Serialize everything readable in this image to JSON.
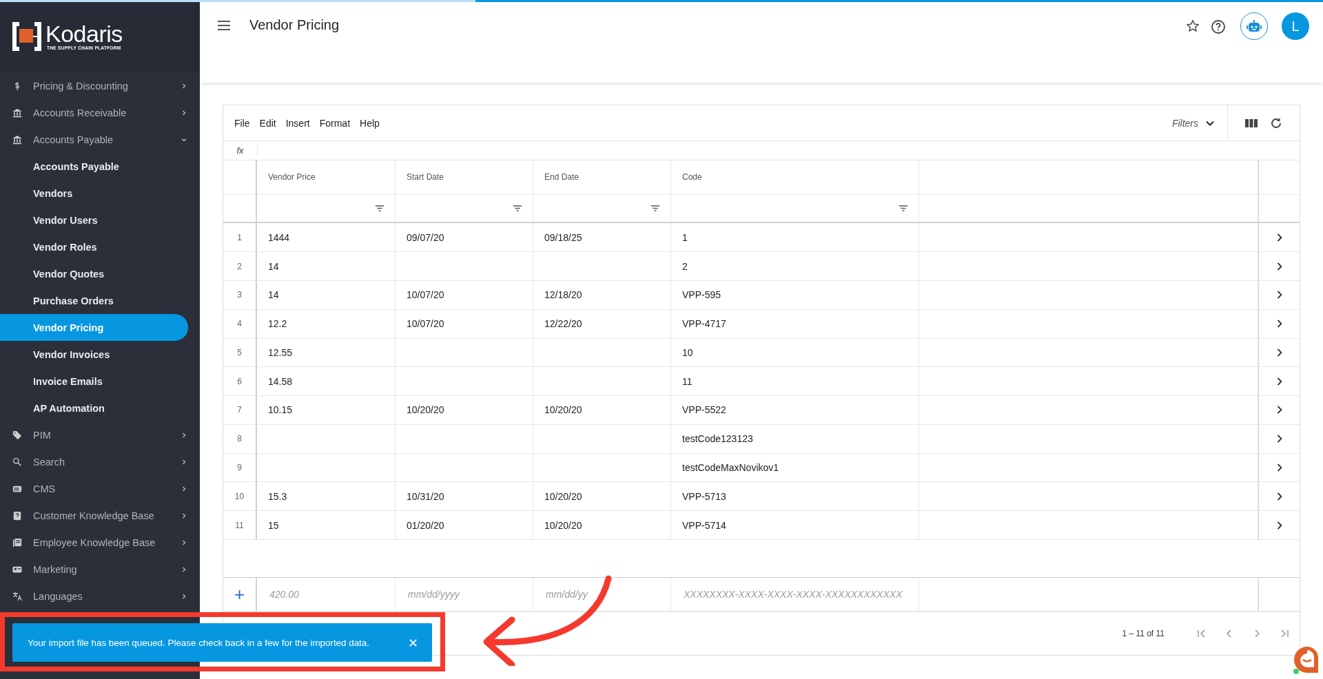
{
  "sidebar": {
    "logo": {
      "name": "Kodaris",
      "tagline": "THE SUPPLY CHAIN PLATFORM"
    },
    "items": [
      {
        "label": "Pricing & Discounting",
        "expanded": false
      },
      {
        "label": "Accounts Receivable",
        "expanded": false
      },
      {
        "label": "Accounts Payable",
        "expanded": true,
        "children": [
          {
            "label": "Accounts Payable",
            "selected": false
          },
          {
            "label": "Vendors",
            "selected": false
          },
          {
            "label": "Vendor Users",
            "selected": false
          },
          {
            "label": "Vendor Roles",
            "selected": false
          },
          {
            "label": "Vendor Quotes",
            "selected": false
          },
          {
            "label": "Purchase Orders",
            "selected": false
          },
          {
            "label": "Vendor Pricing",
            "selected": true
          },
          {
            "label": "Vendor Invoices",
            "selected": false
          },
          {
            "label": "Invoice Emails",
            "selected": false
          },
          {
            "label": "AP Automation",
            "selected": false
          }
        ]
      },
      {
        "label": "PIM",
        "expanded": false
      },
      {
        "label": "Search",
        "expanded": false
      },
      {
        "label": "CMS",
        "expanded": false
      },
      {
        "label": "Customer Knowledge Base",
        "expanded": false
      },
      {
        "label": "Employee Knowledge Base",
        "expanded": false
      },
      {
        "label": "Marketing",
        "expanded": false
      },
      {
        "label": "Languages",
        "expanded": false
      }
    ]
  },
  "top_bar": {
    "title": "Vendor Pricing",
    "avatar": "L"
  },
  "grid": {
    "menu": [
      "File",
      "Edit",
      "Insert",
      "Format",
      "Help"
    ],
    "filters": "Filters",
    "formula_label": "fx",
    "columns": [
      "Vendor Price",
      "Start Date",
      "End Date",
      "Code"
    ],
    "rows": [
      {
        "number": "1",
        "cells": [
          "1444",
          "09/07/20",
          "09/18/25",
          "1"
        ]
      },
      {
        "number": "2",
        "cells": [
          "14",
          "",
          "",
          "2"
        ]
      },
      {
        "number": "3",
        "cells": [
          "14",
          "10/07/20",
          "12/18/20",
          "VPP-595"
        ]
      },
      {
        "number": "4",
        "cells": [
          "12.2",
          "10/07/20",
          "12/22/20",
          "VPP-4717"
        ]
      },
      {
        "number": "5",
        "cells": [
          "12.55",
          "",
          "",
          "10"
        ]
      },
      {
        "number": "6",
        "cells": [
          "14.58",
          "",
          "",
          "11"
        ]
      },
      {
        "number": "7",
        "cells": [
          "10.15",
          "10/20/20",
          "10/20/20",
          "VPP-5522"
        ]
      },
      {
        "number": "8",
        "cells": [
          "",
          "",
          "",
          "testCode123123"
        ]
      },
      {
        "number": "9",
        "cells": [
          "",
          "",
          "",
          "testCodeMaxNovikov1"
        ]
      },
      {
        "number": "10",
        "cells": [
          "15.3",
          "10/31/20",
          "10/20/20",
          "VPP-5713"
        ]
      },
      {
        "number": "11",
        "cells": [
          "15",
          "01/20/20",
          "10/20/20",
          "VPP-5714"
        ]
      }
    ],
    "new_row": {
      "add": "+",
      "placeholders": [
        "420.00",
        "mm/dd/yyyy",
        "mm/dd/yy",
        "XXXXXXXX-XXXX-XXXX-XXXX-XXXXXXXXXXXX"
      ]
    },
    "pagination": "1 – 11 of 11"
  },
  "toast": {
    "message": "Your import file has been queued. Please check back in a few for the imported data.",
    "close": "✕"
  }
}
